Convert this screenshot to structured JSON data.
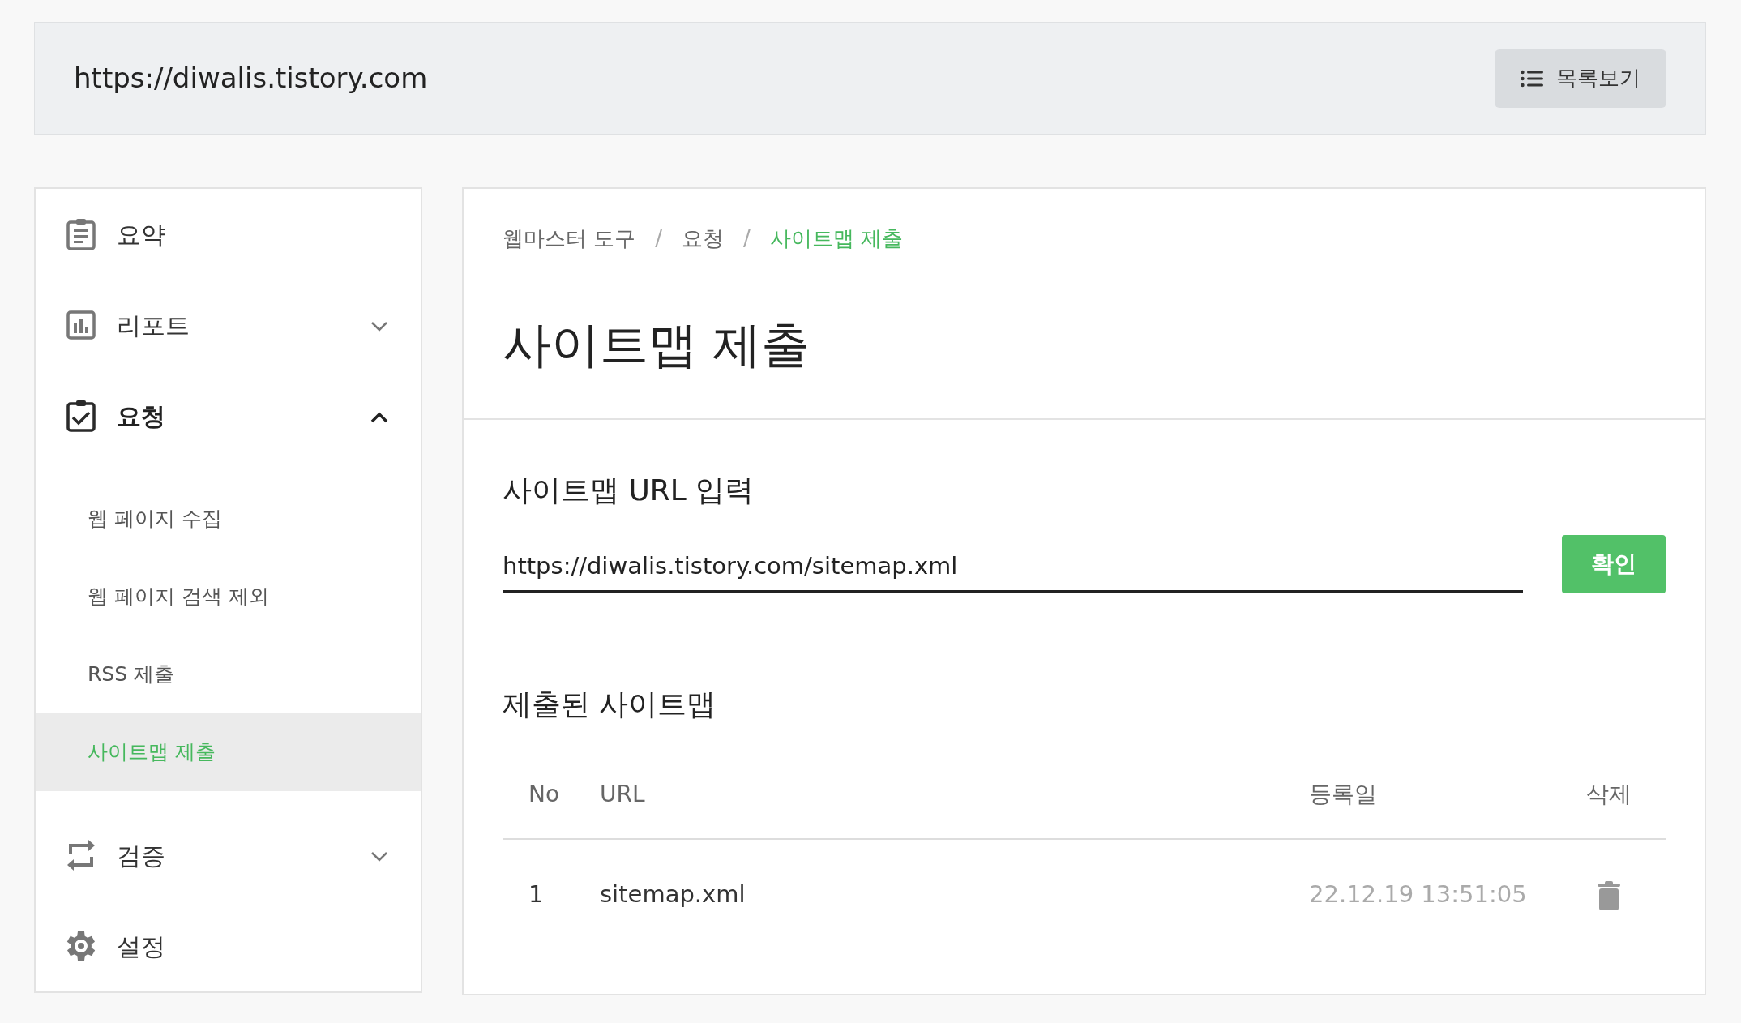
{
  "top_bar": {
    "url": "https://diwalis.tistory.com",
    "list_button": "목록보기"
  },
  "sidebar": {
    "items": [
      {
        "label": "요약",
        "kind": "link"
      },
      {
        "label": "리포트",
        "kind": "group",
        "expanded": false
      },
      {
        "label": "요청",
        "kind": "group",
        "expanded": true,
        "children": [
          {
            "label": "웹 페이지 수집",
            "selected": false
          },
          {
            "label": "웹 페이지 검색 제외",
            "selected": false
          },
          {
            "label": "RSS 제출",
            "selected": false
          },
          {
            "label": "사이트맵 제출",
            "selected": true
          }
        ]
      },
      {
        "label": "검증",
        "kind": "group",
        "expanded": false
      },
      {
        "label": "설정",
        "kind": "link"
      }
    ]
  },
  "breadcrumb": [
    {
      "kind": "link",
      "label": "웹마스터 도구",
      "current": false
    },
    {
      "kind": "separator",
      "label": "/"
    },
    {
      "kind": "link",
      "label": "요청",
      "current": false
    },
    {
      "kind": "separator",
      "label": "/"
    },
    {
      "kind": "link",
      "label": "사이트맵 제출",
      "current": true
    }
  ],
  "page_title": "사이트맵 제출",
  "url_form": {
    "heading": "사이트맵 URL 입력",
    "value": "https://diwalis.tistory.com/sitemap.xml",
    "submit": "확인"
  },
  "submitted": {
    "heading": "제출된 사이트맵",
    "columns": [
      "No",
      "URL",
      "등록일",
      "삭제"
    ],
    "rows": [
      {
        "no": "1",
        "url": "sitemap.xml",
        "date": "22.12.19 13:51:05"
      }
    ]
  }
}
